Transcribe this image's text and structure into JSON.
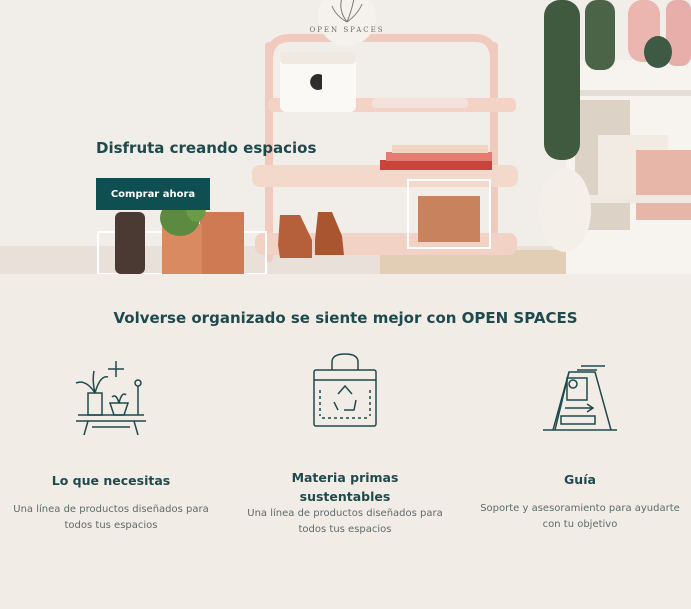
{
  "brand": {
    "name": "OPEN SPACES",
    "logo_text": "OPEN SPACES"
  },
  "hero": {
    "title": "Disfruta creando espacios",
    "cta_label": "Comprar ahora"
  },
  "section": {
    "title": "Volverse organizado se siente mejor con OPEN SPACES"
  },
  "features": [
    {
      "icon": "plants-shelf-icon",
      "title": "Lo que necesitas",
      "description": "Una línea de productos diseñados para todos tus espacios"
    },
    {
      "icon": "recycle-bag-icon",
      "title": "Materia primas sustentables",
      "description": "Una línea de productos diseñados para todos tus espacios"
    },
    {
      "icon": "guide-sign-icon",
      "title": "Guía",
      "description": "Soporte y asesoramiento para ayudarte con tu objetivo"
    }
  ],
  "colors": {
    "accent": "#0f4f51",
    "text": "#1f4a4d",
    "background": "#f2ece6"
  }
}
